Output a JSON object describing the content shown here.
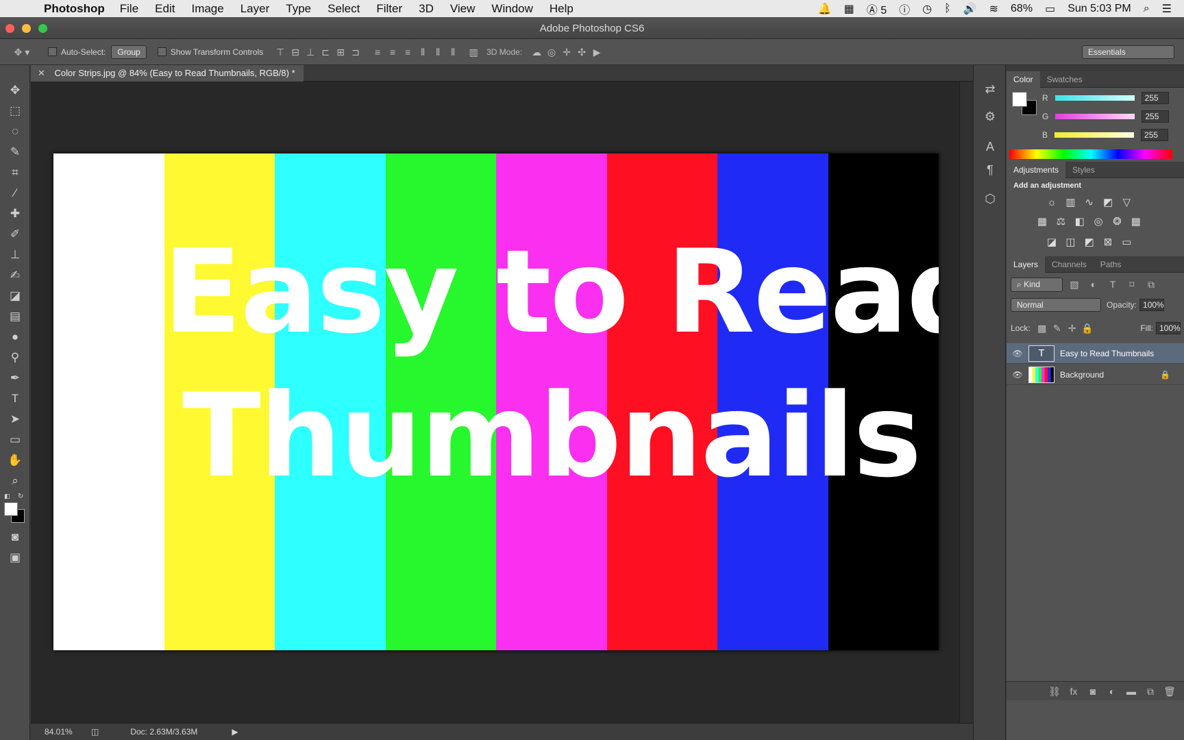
{
  "menubar": {
    "app": "Photoshop",
    "items": [
      "File",
      "Edit",
      "Image",
      "Layer",
      "Type",
      "Select",
      "Filter",
      "3D",
      "View",
      "Window",
      "Help"
    ],
    "status": {
      "badge_count": "5",
      "battery": "68%",
      "clock": "Sun 5:03 PM"
    }
  },
  "window": {
    "title": "Adobe Photoshop CS6"
  },
  "options": {
    "auto_select_label": "Auto-Select:",
    "auto_select_value": "Group",
    "show_transform_label": "Show Transform Controls",
    "mode3d_label": "3D Mode:",
    "workspace": "Essentials"
  },
  "document": {
    "tab_title": "Color Strips.jpg @ 84% (Easy to Read Thumbnails, RGB/8) *",
    "text_line1": "Easy to Read",
    "text_line2": "Thumbnails",
    "strip_colors": [
      "#ffffff",
      "#fef931",
      "#2effff",
      "#27f82d",
      "#fa2fef",
      "#ff0f22",
      "#1f2bf5",
      "#000000"
    ],
    "zoom": "84.01%",
    "doc_size": "Doc: 2.63M/3.63M"
  },
  "color_panel": {
    "tabs": [
      "Color",
      "Swatches"
    ],
    "channels": [
      {
        "label": "R",
        "value": "255",
        "color": "#3ee3ea"
      },
      {
        "label": "G",
        "value": "255",
        "color": "#e84be3"
      },
      {
        "label": "B",
        "value": "255",
        "color": "#f0ea3a"
      }
    ]
  },
  "adjustments_panel": {
    "tabs": [
      "Adjustments",
      "Styles"
    ],
    "heading": "Add an adjustment"
  },
  "layers_panel": {
    "tabs": [
      "Layers",
      "Channels",
      "Paths"
    ],
    "kind_label": "Kind",
    "blend_mode": "Normal",
    "opacity_label": "Opacity:",
    "opacity_value": "100%",
    "lock_label": "Lock:",
    "fill_label": "Fill:",
    "fill_value": "100%",
    "layers": [
      {
        "name": "Easy to Read Thumbnails",
        "type": "text",
        "selected": true
      },
      {
        "name": "Background",
        "type": "image",
        "selected": false
      }
    ]
  }
}
